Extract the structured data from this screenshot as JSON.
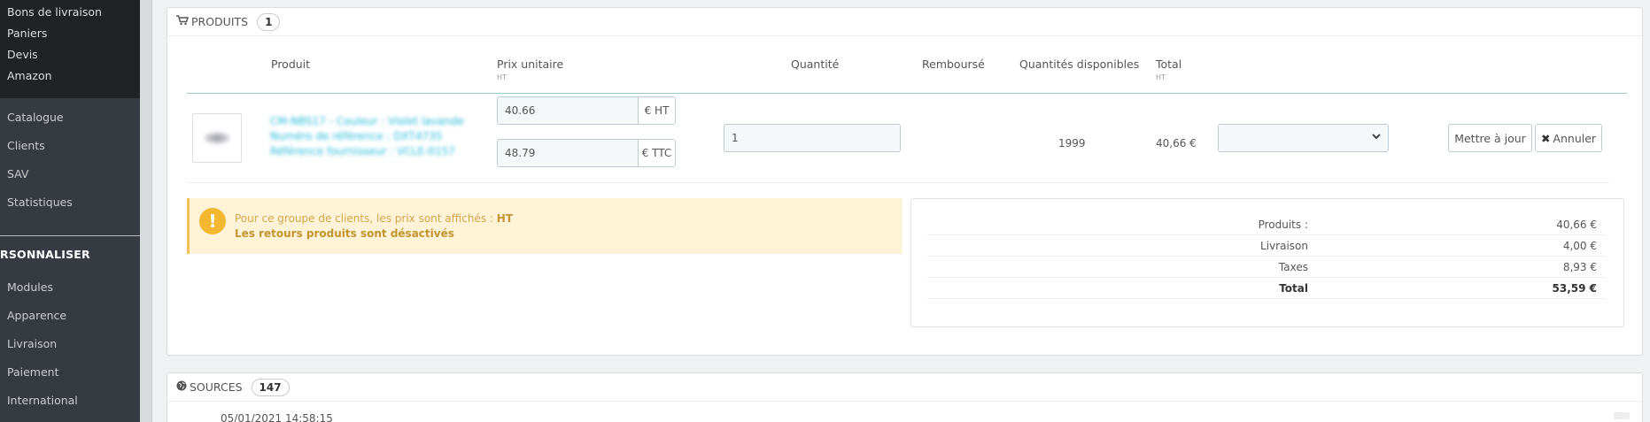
{
  "sidebar": {
    "top_items": [
      {
        "label": "Bons de livraison"
      },
      {
        "label": "Paniers"
      },
      {
        "label": "Devis"
      },
      {
        "label": "Amazon"
      }
    ],
    "group1": [
      {
        "label": "Catalogue"
      },
      {
        "label": "Clients"
      },
      {
        "label": "SAV"
      },
      {
        "label": "Statistiques"
      }
    ],
    "section_title": "RSONNALISER",
    "group2": [
      {
        "label": "Modules"
      },
      {
        "label": "Apparence"
      },
      {
        "label": "Livraison"
      },
      {
        "label": "Paiement"
      },
      {
        "label": "International"
      }
    ]
  },
  "products_panel": {
    "title": "PRODUITS",
    "count": "1",
    "columns": {
      "product": "Produit",
      "unit_price": "Prix unitaire",
      "unit_price_sub": "HT",
      "quantity": "Quantité",
      "refunded": "Remboursé",
      "available": "Quantités disponibles",
      "total": "Total",
      "total_sub": "HT"
    },
    "row": {
      "product_line1": "CM-NBS17 - Couleur : Violet lavande",
      "product_line2": "Numéro de référence : DXT4735",
      "product_line3": "Référence fournisseur : VCLE-0157",
      "price_ht": "40.66",
      "price_ht_addon": "€ HT",
      "price_ttc": "48.79",
      "price_ttc_addon": "€ TTC",
      "quantity": "1",
      "available": "1999",
      "total": "40,66 €",
      "update_button": "Mettre à jour",
      "cancel_button": "Annuler"
    },
    "alert": {
      "line1_prefix": "Pour ce groupe de clients, les prix sont affichés :",
      "line1_strong": "HT",
      "line2": "Les retours produits sont désactivés"
    },
    "totals": [
      {
        "label": "Produits :",
        "value": "40,66 €"
      },
      {
        "label": "Livraison",
        "value": "4,00 €"
      },
      {
        "label": "Taxes",
        "value": "8,93 €"
      },
      {
        "label": "Total",
        "value": "53,59 €"
      }
    ]
  },
  "sources_panel": {
    "title": "SOURCES",
    "count": "147",
    "first_row_partial": "05/01/2021 14:58:15"
  },
  "colors": {
    "sidebar_bg": "#363a41",
    "sidebar_top_bg": "#202226",
    "link": "#25b9d7",
    "alert_bg": "#fff3d7",
    "alert_icon": "#f3b82f",
    "header_line": "#9fcccc"
  }
}
